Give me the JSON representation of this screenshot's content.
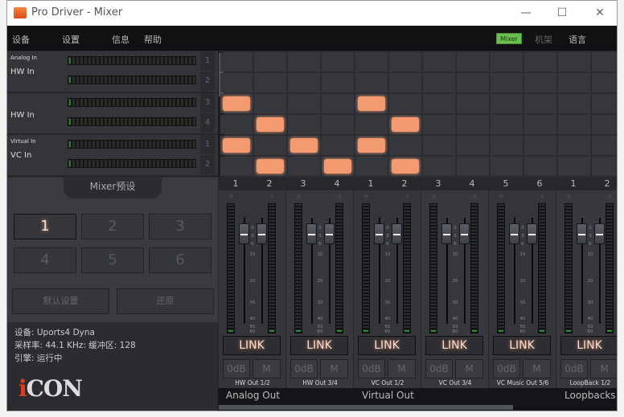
{
  "window": {
    "title": "Pro Driver - Mixer",
    "minimize": "—",
    "maximize": "☐",
    "close": "✕"
  },
  "menu": {
    "items": [
      "设备",
      "设置",
      "信息",
      "帮助"
    ],
    "mixer": "Mixer",
    "rack": "机架",
    "language": "语言"
  },
  "inputs": [
    {
      "group": "Analog In",
      "name": "HW In",
      "channels": [
        "1",
        "2"
      ]
    },
    {
      "group": "",
      "name": "HW In",
      "channels": [
        "3",
        "4"
      ]
    },
    {
      "group": "Virtual In",
      "name": "VC In",
      "channels": [
        "1",
        "2"
      ]
    }
  ],
  "matrix": {
    "active_color": "#f49a70",
    "routes": [
      [],
      [],
      [
        1,
        5
      ],
      [
        2,
        6
      ],
      [
        1,
        3,
        5
      ],
      [
        2,
        4,
        6
      ]
    ]
  },
  "presets": {
    "title": "Mixer预设",
    "buttons": [
      "1",
      "2",
      "3",
      "4",
      "5",
      "6"
    ],
    "active": "1",
    "default_label": "默认设置",
    "restore_label": "还原"
  },
  "info": {
    "device": "设备: Uports4 Dyna",
    "rate": "采样率: 44.1 KHz:  缓冲区: 128",
    "engine": "引擎: 运行中"
  },
  "logo": {
    "text": "iCON",
    "accent": "#d8401e"
  },
  "strips": [
    {
      "channels": [
        "1",
        "2"
      ],
      "label": "HW Out  1/2"
    },
    {
      "channels": [
        "3",
        "4"
      ],
      "label": "HW Out  3/4"
    },
    {
      "channels": [
        "1",
        "2"
      ],
      "label": "VC Out  1/2"
    },
    {
      "channels": [
        "3",
        "4"
      ],
      "label": "VC Out  3/4"
    },
    {
      "channels": [
        "5",
        "6"
      ],
      "label": "VC Music Out  5/6"
    },
    {
      "channels": [
        "1",
        "2"
      ],
      "label": "LoopBack 1/2"
    }
  ],
  "strip_common": {
    "meter_top": "0",
    "link": "LINK",
    "zero_db": "0dB",
    "mute": "M",
    "scale": [
      "0",
      "3",
      "6",
      "10",
      "20",
      "30",
      "40",
      "50",
      "60"
    ]
  },
  "sections": {
    "analog": "Analog Out",
    "virtual": "Virtual Out",
    "loopbacks": "Loopbacks"
  }
}
